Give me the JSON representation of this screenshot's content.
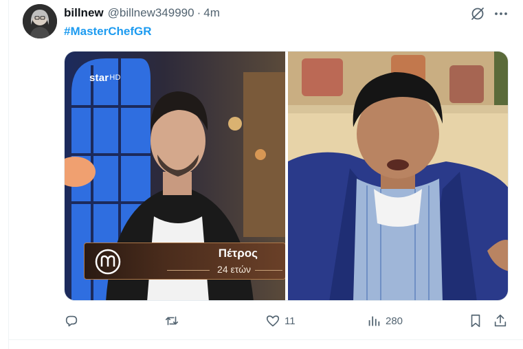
{
  "tweet": {
    "display_name": "billnew",
    "handle": "@billnew349990",
    "separator": "·",
    "time": "4m",
    "hashtag": "#MasterChefGR"
  },
  "media": {
    "left_panel": {
      "channel_logo": "star",
      "channel_logo_suffix": "HD",
      "contestant_name": "Πέτρος",
      "contestant_age": "24 ετών",
      "show_logo_icon": "masterchef-logo-icon"
    },
    "right_panel": {
      "content": "tv-still-man-in-blue-blazer"
    }
  },
  "actions": {
    "reply_icon": "reply-icon",
    "retweet_icon": "retweet-icon",
    "like_icon": "heart-icon",
    "like_count": "11",
    "views_icon": "views-icon",
    "views_count": "280",
    "bookmark_icon": "bookmark-icon",
    "share_icon": "share-icon"
  },
  "colors": {
    "accent": "#1d9bf0",
    "text": "#0f1419",
    "secondary": "#536471"
  }
}
